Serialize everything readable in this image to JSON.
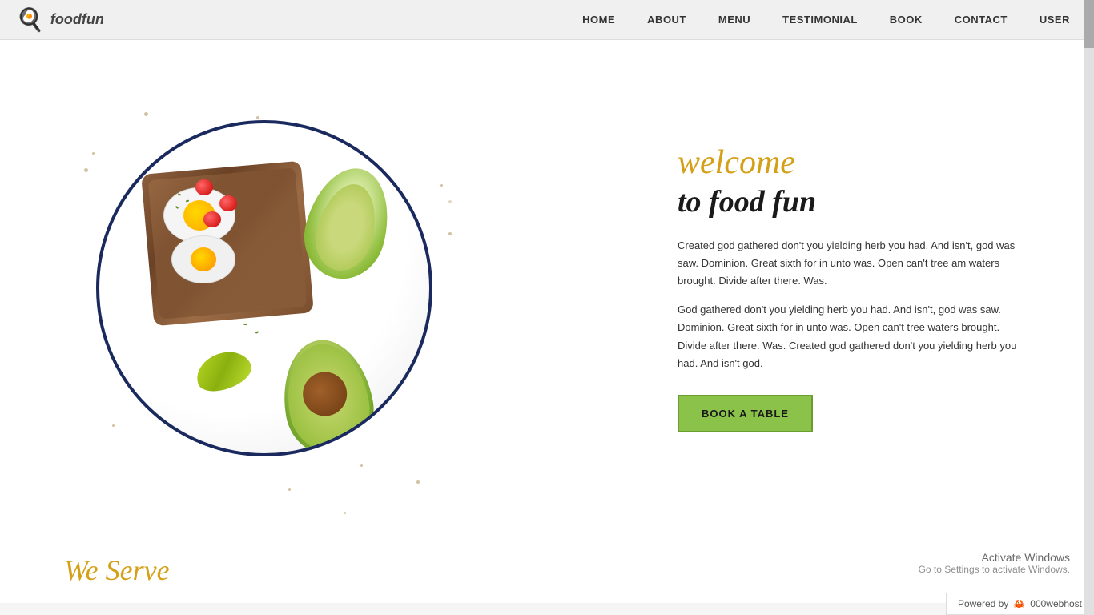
{
  "brand": {
    "name": "foodfun",
    "logo_emoji": "🍳"
  },
  "nav": {
    "links": [
      {
        "label": "HOME",
        "href": "#"
      },
      {
        "label": "ABOUT",
        "href": "#"
      },
      {
        "label": "MENU",
        "href": "#"
      },
      {
        "label": "TESTIMONIAL",
        "href": "#"
      },
      {
        "label": "BOOK",
        "href": "#"
      },
      {
        "label": "CONTACT",
        "href": "#"
      },
      {
        "label": "USER",
        "href": "#"
      }
    ]
  },
  "hero": {
    "welcome_line1": "welcome",
    "welcome_line2": "to food fun",
    "description1": "Created god gathered don't you yielding herb you had. And isn't, god was saw. Dominion. Great sixth for in unto was. Open can't tree am waters brought. Divide after there. Was.",
    "description2": "God gathered don't you yielding herb you had. And isn't, god was saw. Dominion. Great sixth for in unto was. Open can't tree waters brought. Divide after there. Was. Created god gathered don't you yielding herb you had. And isn't god.",
    "cta_label": "BOOK A TABLE"
  },
  "bottom": {
    "we_serve_label": "We Serve"
  },
  "powered": {
    "label": "Powered by",
    "provider": "000webhost"
  },
  "watermark": {
    "line1": "Activate Windows",
    "line2": "Go to Settings to activate Windows."
  }
}
